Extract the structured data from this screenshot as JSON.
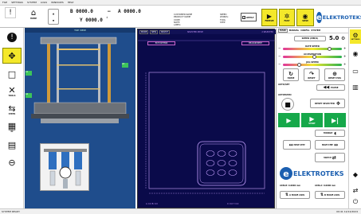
{
  "menu": [
    "FILE",
    "SETTINGS",
    "SYSTEM",
    "LOGS",
    "WINDOWS",
    "HELP"
  ],
  "toolbar": {
    "home_label": "HOME",
    "coord_b": "B 0000.0",
    "coord_a": "A 0000.0",
    "coord_y": "Y 0000.0",
    "dash": "–",
    "info_lines": [
      "CUSTOMER NAME",
      "PRODUCT NAME",
      "CODE:",
      "NOTE:",
      "LABEL:"
    ],
    "info_right": [
      "SPEED",
      "WORKS:",
      "TOOL",
      "STEP"
    ],
    "apply_label": "APPLY",
    "yellow_buttons": [
      {
        "icon": "play-icon",
        "label": "FREEZE"
      },
      {
        "icon": "fan-icon",
        "label": "FAST"
      },
      {
        "icon": "eye-icon",
        "label": "VIEW"
      }
    ],
    "brand": "ELEKTROTEKS"
  },
  "left_sidebar": [
    {
      "icon": "alert-icon",
      "glyph": "!",
      "label": "STOP"
    },
    {
      "icon": "move-icon",
      "glyph": "✥",
      "label": ""
    },
    {
      "icon": "square-icon",
      "glyph": "□",
      "label": ""
    },
    {
      "icon": "tools-icon",
      "glyph": "✕",
      "label": "TOOLS"
    },
    {
      "icon": "arrows-icon",
      "glyph": "⇆",
      "label": "STEPS"
    },
    {
      "icon": "grid-icon",
      "glyph": "▦",
      "label": "IO"
    },
    {
      "icon": "image-icon",
      "glyph": "▤",
      "label": ""
    },
    {
      "icon": "link-icon",
      "glyph": "⊖",
      "label": ""
    }
  ],
  "machine_panel": {
    "header": "TOP VIEW",
    "side_tags": [
      "A1",
      "A2",
      "A3"
    ]
  },
  "canvas": {
    "tabs": [
      "MODE",
      "NEW",
      "SELECT"
    ],
    "top_label": "SELECTED PIECE",
    "top_right": "2 SELECTED",
    "btn_left": "EDIT PATTERN",
    "btn_right": "MEASUREMENT",
    "bottom_left": "A: 0.0 B: 0.0",
    "bottom_right": "X: 0.0 Y: 0.0"
  },
  "control": {
    "tabs": [
      "MAIN",
      "MANUAL",
      "CONFIG",
      "SYSTEM"
    ],
    "speed_label": "SPEED (MM/S)",
    "speed_value": "5.0",
    "slider_labels": [
      "RATE SPEED",
      "ACCELERATION",
      "JOG SPEED"
    ],
    "slider_fill": [
      0.8,
      0.55,
      0.3
    ],
    "buttons": [
      "HOME",
      "RESET",
      "RESET POS"
    ],
    "labels": [
      "AUTO/SET",
      "PAUSE",
      "RESET SELECTED",
      "START",
      "MIDDLE"
    ],
    "brand": "ELEKTROTEKS",
    "bottom_left": "A MOVE AXIS",
    "bottom_right": "B MOVE AXIS",
    "readout_left": "AXIS-B: 0.0000 mm",
    "readout_right": "AXIS-A: 0.0000 mm"
  },
  "right_sidebar": [
    {
      "icon": "gear-icon",
      "glyph": "⚙",
      "label": "SETTINGS"
    },
    {
      "icon": "target-icon",
      "glyph": "◉",
      "label": ""
    },
    {
      "icon": "paper-icon",
      "glyph": "▭",
      "label": ""
    },
    {
      "icon": "chart-icon",
      "glyph": "▥",
      "label": ""
    },
    {
      "icon": "tag-icon",
      "glyph": "◆",
      "label": ""
    },
    {
      "icon": "transfer-icon",
      "glyph": "⇄",
      "label": ""
    },
    {
      "icon": "power-icon",
      "glyph": "⏻",
      "label": ""
    }
  ],
  "status": {
    "left": "SYSTEM READY",
    "right": "09:41 12/12/2024"
  },
  "colors": {
    "accent_yellow": "#f4e82a",
    "machine_blue": "#1f4d8c",
    "canvas_navy": "#0a0a4a",
    "green": "#16a84a",
    "brand_blue": "#1b5fb0"
  }
}
